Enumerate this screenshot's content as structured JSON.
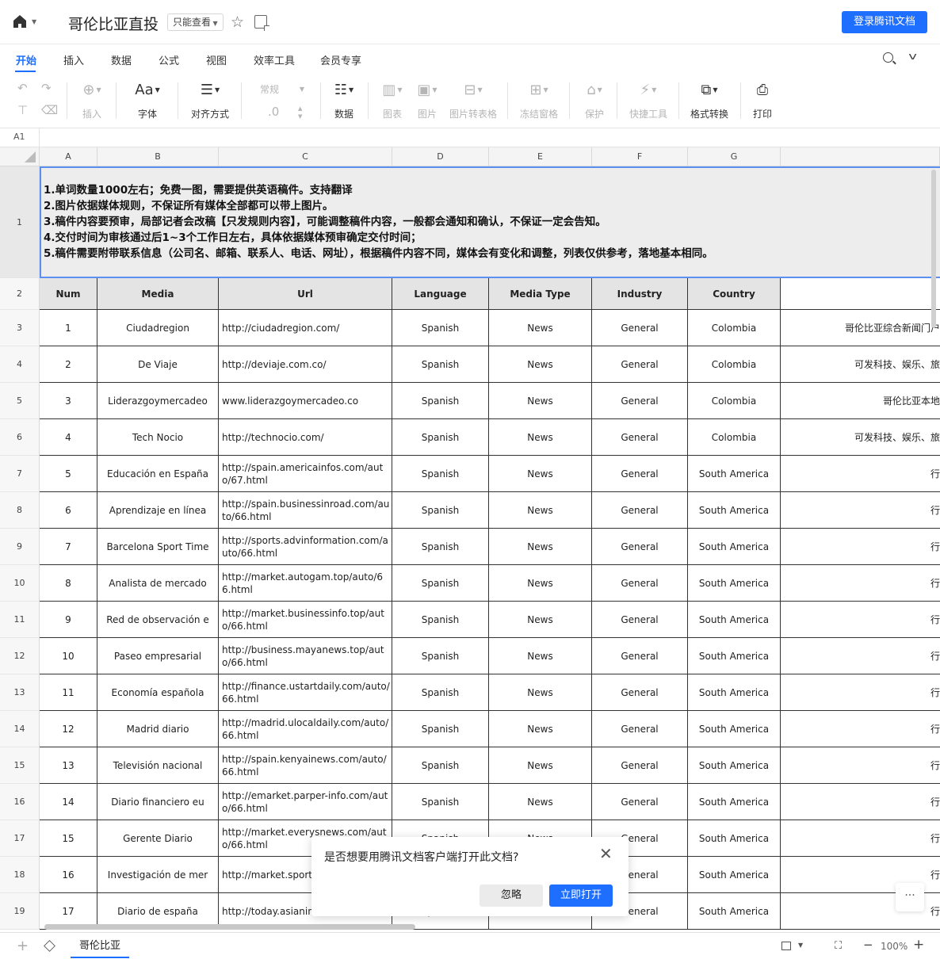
{
  "app": {
    "title": "哥伦比亚直投",
    "readonly_label": "只能查看",
    "login_label": "登录腾讯文档"
  },
  "menu": {
    "tabs": [
      "开始",
      "插入",
      "数据",
      "公式",
      "视图",
      "效率工具",
      "会员专享"
    ],
    "active": "开始"
  },
  "toolbar": {
    "insert": "插入",
    "font": "字体",
    "align": "对齐方式",
    "number_format": "常规",
    "decimal": ".0",
    "data": "数据",
    "chart": "图表",
    "image": "图片",
    "image_to_table": "图片转表格",
    "freeze": "冻结窗格",
    "protect": "保护",
    "quick_tools": "快捷工具",
    "format_convert": "格式转换",
    "print": "打印"
  },
  "formula_bar": {
    "cell_ref": "A1"
  },
  "sheet": {
    "columns": [
      "A",
      "B",
      "C",
      "D",
      "E",
      "F",
      "G"
    ],
    "note_lines": [
      "1.单词数量1000左右；免费一图，需要提供英语稿件。支持翻译",
      "2.图片依据媒体规则，不保证所有媒体全部都可以带上图片。",
      "3.稿件内容要预审，局部记者会改稿【只发规则内容】，可能调整稿件内容，一般都会通知和确认，不保证一定会告知。",
      "4.交付时间为审核通过后1~3个工作日左右，具体依据媒体预审确定交付时间；",
      "5.稿件需要附带联系信息（公司名、邮箱、联系人、电话、网址），根据稿件内容不同，媒体会有变化和调整，列表仅供参考，落地基本相同。"
    ],
    "headers": [
      "Num",
      "Media",
      "Url",
      "Language",
      "Media Type",
      "Industry",
      "Country"
    ],
    "rows": [
      {
        "num": "1",
        "media": "Ciudadregion",
        "url": "http://ciudadregion.com/",
        "language": "Spanish",
        "type": "News",
        "industry": "General",
        "country": "Colombia",
        "extra": "哥伦比亚综合新闻门户"
      },
      {
        "num": "2",
        "media": "De Viaje",
        "url": "http://deviaje.com.co/",
        "language": "Spanish",
        "type": "News",
        "industry": "General",
        "country": "Colombia",
        "extra": "可发科技、娱乐、旅"
      },
      {
        "num": "3",
        "media": "Liderazgoymercadeo",
        "url": "www.liderazgoymercadeo.co",
        "language": "Spanish",
        "type": "News",
        "industry": "General",
        "country": "Colombia",
        "extra": "哥伦比亚本地"
      },
      {
        "num": "4",
        "media": "Tech Nocio",
        "url": "http://technocio.com/",
        "language": "Spanish",
        "type": "News",
        "industry": "General",
        "country": "Colombia",
        "extra": "可发科技、娱乐、旅"
      },
      {
        "num": "5",
        "media": "Educación en España",
        "url": "http://spain.americainfos.com/auto/67.html",
        "language": "Spanish",
        "type": "News",
        "industry": "General",
        "country": "South America",
        "extra": "行"
      },
      {
        "num": "6",
        "media": "Aprendizaje en línea",
        "url": "http://spain.businessinroad.com/auto/66.html",
        "language": "Spanish",
        "type": "News",
        "industry": "General",
        "country": "South America",
        "extra": "行"
      },
      {
        "num": "7",
        "media": "Barcelona Sport Time",
        "url": "http://sports.advinformation.com/auto/66.html",
        "language": "Spanish",
        "type": "News",
        "industry": "General",
        "country": "South America",
        "extra": "行"
      },
      {
        "num": "8",
        "media": "Analista de mercado",
        "url": "http://market.autogam.top/auto/66.html",
        "language": "Spanish",
        "type": "News",
        "industry": "General",
        "country": "South America",
        "extra": "行"
      },
      {
        "num": "9",
        "media": "Red de observación e",
        "url": "http://market.businessinfo.top/auto/66.html",
        "language": "Spanish",
        "type": "News",
        "industry": "General",
        "country": "South America",
        "extra": "行"
      },
      {
        "num": "10",
        "media": "Paseo empresarial",
        "url": "http://business.mayanews.top/auto/66.html",
        "language": "Spanish",
        "type": "News",
        "industry": "General",
        "country": "South America",
        "extra": "行"
      },
      {
        "num": "11",
        "media": "Economía española",
        "url": "http://finance.ustartdaily.com/auto/66.html",
        "language": "Spanish",
        "type": "News",
        "industry": "General",
        "country": "South America",
        "extra": "行"
      },
      {
        "num": "12",
        "media": "Madrid diario",
        "url": "http://madrid.ulocaldaily.com/auto/66.html",
        "language": "Spanish",
        "type": "News",
        "industry": "General",
        "country": "South America",
        "extra": "行"
      },
      {
        "num": "13",
        "media": "Televisión nacional",
        "url": "http://spain.kenyainews.com/auto/66.html",
        "language": "Spanish",
        "type": "News",
        "industry": "General",
        "country": "South America",
        "extra": "行"
      },
      {
        "num": "14",
        "media": "Diario financiero eu",
        "url": "http://emarket.parper-info.com/auto/66.html",
        "language": "Spanish",
        "type": "News",
        "industry": "General",
        "country": "South America",
        "extra": "行"
      },
      {
        "num": "15",
        "media": "Gerente Diario",
        "url": "http://market.everysnews.com/auto/66.html",
        "language": "Spanish",
        "type": "News",
        "industry": "General",
        "country": "South America",
        "extra": "行"
      },
      {
        "num": "16",
        "media": "Investigación de mer",
        "url": "http://market.sportsto/66.html",
        "language": "Spanish",
        "type": "News",
        "industry": "General",
        "country": "South America",
        "extra": "行"
      },
      {
        "num": "17",
        "media": "Diario de españa",
        "url": "http://today.asianinhtml",
        "language": "Spanish",
        "type": "News",
        "industry": "General",
        "country": "South America",
        "extra": "行"
      }
    ]
  },
  "bottom": {
    "sheet_tab": "哥伦比亚",
    "zoom": "100%"
  },
  "dialog": {
    "message": "是否想要用腾讯文档客户端打开此文档?",
    "ignore_label": "忽略",
    "open_label": "立即打开"
  },
  "colors": {
    "accent": "#1e6fff",
    "header_fill": "#e4e4e4",
    "note_fill": "#ededed"
  }
}
